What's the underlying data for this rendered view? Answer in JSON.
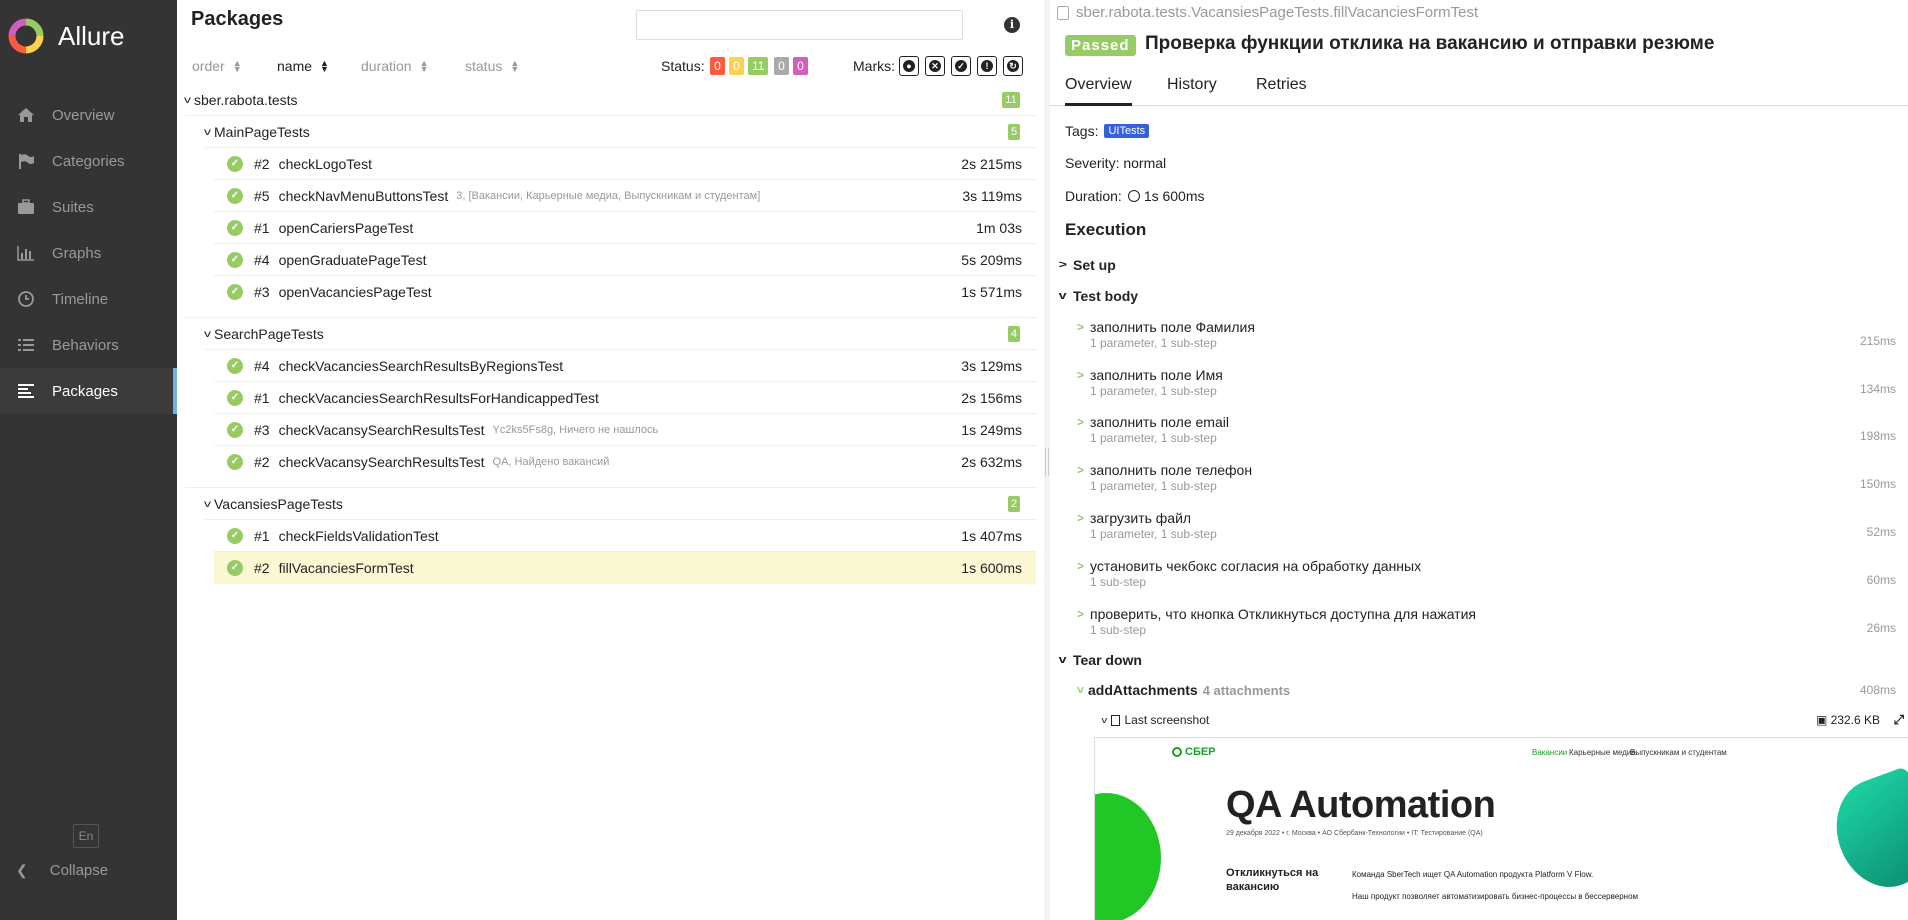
{
  "app": {
    "name": "Allure"
  },
  "sidebar": {
    "items": [
      {
        "label": "Overview",
        "icon": "home-icon"
      },
      {
        "label": "Categories",
        "icon": "flag-icon"
      },
      {
        "label": "Suites",
        "icon": "briefcase-icon"
      },
      {
        "label": "Graphs",
        "icon": "bar-chart-icon"
      },
      {
        "label": "Timeline",
        "icon": "clock-icon"
      },
      {
        "label": "Behaviors",
        "icon": "list-icon"
      },
      {
        "label": "Packages",
        "icon": "align-left-icon"
      }
    ],
    "active": "Packages",
    "language": "En",
    "collapse_label": "Collapse"
  },
  "packages": {
    "title": "Packages",
    "search": {
      "value": "",
      "placeholder": ""
    },
    "sort": {
      "order": "order",
      "name": "name",
      "duration": "duration",
      "status": "status"
    },
    "status_label": "Status:",
    "status_counts": [
      {
        "value": "0",
        "color": "#fd5a3e"
      },
      {
        "value": "0",
        "color": "#ffd050"
      },
      {
        "value": "11",
        "color": "#97cc64"
      },
      {
        "value": "0",
        "color": "#aaaaaa"
      },
      {
        "value": "0",
        "color": "#d35ebe"
      }
    ],
    "marks_label": "Marks:",
    "root": {
      "name": "sber.rabota.tests",
      "count": "11"
    },
    "groups": [
      {
        "name": "MainPageTests",
        "count": "5",
        "tests": [
          {
            "num": "#2",
            "name": "checkLogoTest",
            "params": "",
            "duration": "2s 215ms"
          },
          {
            "num": "#5",
            "name": "checkNavMenuButtonsTest",
            "params": "3, [Вакансии, Карьерные медиа, Выпускникам и студентам]",
            "duration": "3s 119ms"
          },
          {
            "num": "#1",
            "name": "openCariersPageTest",
            "params": "",
            "duration": "1m 03s"
          },
          {
            "num": "#4",
            "name": "openGraduatePageTest",
            "params": "",
            "duration": "5s 209ms"
          },
          {
            "num": "#3",
            "name": "openVacanciesPageTest",
            "params": "",
            "duration": "1s 571ms"
          }
        ]
      },
      {
        "name": "SearchPageTests",
        "count": "4",
        "tests": [
          {
            "num": "#4",
            "name": "checkVacanciesSearchResultsByRegionsTest",
            "params": "",
            "duration": "3s 129ms"
          },
          {
            "num": "#1",
            "name": "checkVacanciesSearchResultsForHandicappedTest",
            "params": "",
            "duration": "2s 156ms"
          },
          {
            "num": "#3",
            "name": "checkVacansySearchResultsTest",
            "params": "Yc2ks5Fs8g, Ничего не нашлось",
            "duration": "1s 249ms"
          },
          {
            "num": "#2",
            "name": "checkVacansySearchResultsTest",
            "params": "QA, Найдено вакансий",
            "duration": "2s 632ms"
          }
        ]
      },
      {
        "name": "VacansiesPageTests",
        "count": "2",
        "tests": [
          {
            "num": "#1",
            "name": "checkFieldsValidationTest",
            "params": "",
            "duration": "1s 407ms"
          },
          {
            "num": "#2",
            "name": "fillVacanciesFormTest",
            "params": "",
            "duration": "1s 600ms",
            "selected": true
          }
        ]
      }
    ]
  },
  "detail": {
    "path": "sber.rabota.tests.VacansiesPageTests.fillVacanciesFormTest",
    "status": "Passed",
    "title": "Проверка функции отклика на вакансию и отправки резюме",
    "tabs": [
      "Overview",
      "History",
      "Retries"
    ],
    "tags_label": "Tags:",
    "tag": "UITests",
    "severity": "Severity: normal",
    "duration_label": "Duration:",
    "duration": "1s 600ms",
    "execution": "Execution",
    "setup": "Set up",
    "test_body": "Test body",
    "steps": [
      {
        "name": "заполнить поле Фамилия",
        "meta": "1 parameter, 1 sub-step",
        "duration": "215ms"
      },
      {
        "name": "заполнить поле Имя",
        "meta": "1 parameter, 1 sub-step",
        "duration": "134ms"
      },
      {
        "name": "заполнить поле email",
        "meta": "1 parameter, 1 sub-step",
        "duration": "198ms"
      },
      {
        "name": "заполнить поле телефон",
        "meta": "1 parameter, 1 sub-step",
        "duration": "150ms"
      },
      {
        "name": "загрузить файл",
        "meta": "1 parameter, 1 sub-step",
        "duration": "52ms"
      },
      {
        "name": "установить чекбокс согласия на обработку данных",
        "meta": "1 sub-step",
        "duration": "60ms"
      },
      {
        "name": "проверить, что кнопка Откликнуться доступна для нажатия",
        "meta": "1 sub-step",
        "duration": "26ms"
      }
    ],
    "teardown": "Tear down",
    "attachment_step": {
      "name": "addAttachments",
      "count": "4 attachments",
      "duration": "408ms"
    },
    "screenshot": {
      "name": "Last screenshot",
      "size": "232.6 KB"
    },
    "preview": {
      "logo": "СБЕР",
      "nav": [
        "Вакансии",
        "Карьерные медиа",
        "Выпускникам и студентам"
      ],
      "heading": "QA Automation",
      "meta": "29 декабря 2022 • г. Москва • АО Сбербанк-Технологии • IT: Тестирование (QA)",
      "apply": "Откликнуться на вакансию",
      "desc1": "Команда SberTech ищет QA Automation продукта Platform V Flow.",
      "desc2": "Наш продукт позволяет автоматизировать бизнес-процессы в бессерверном"
    }
  }
}
